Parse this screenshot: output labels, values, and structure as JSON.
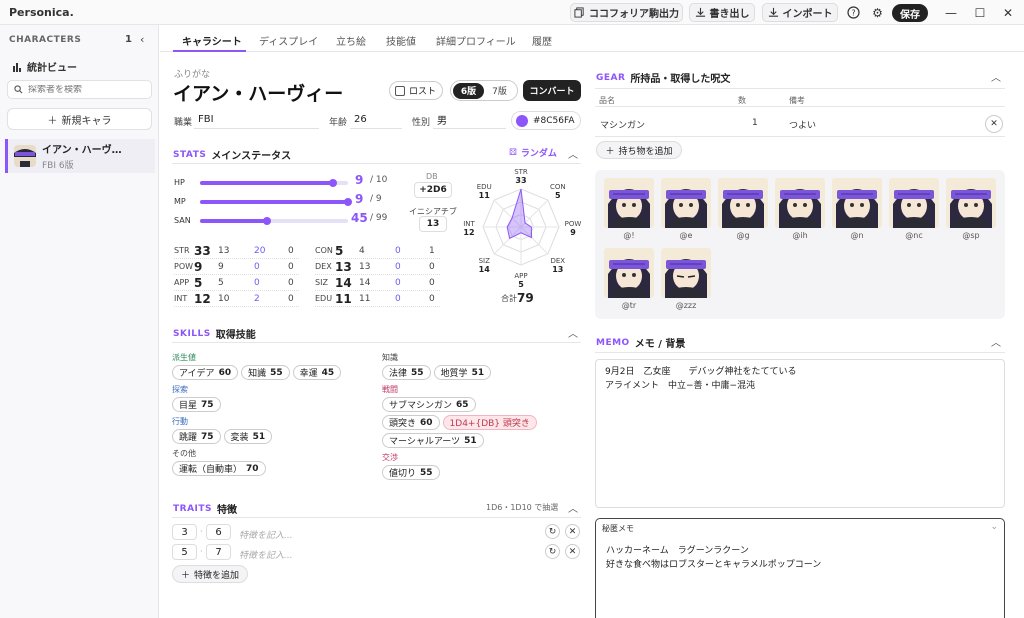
{
  "app": {
    "title": "Personica."
  },
  "toolbar": {
    "ccfolia": "ココフォリア駒出力",
    "export": "書き出し",
    "import": "インポート",
    "save": "保存"
  },
  "sidebar": {
    "header": "CHARACTERS",
    "count": "1",
    "stats_view": "統計ビュー",
    "search_placeholder": "探索者を検索",
    "new_char": "新規キャラ",
    "characters": [
      {
        "name": "イアン・ハーヴ…",
        "sub": "FBI  6版"
      }
    ]
  },
  "tabs": [
    "キャラシート",
    "ディスプレイ",
    "立ち絵",
    "技能値",
    "詳細プロフィール",
    "履歴"
  ],
  "character": {
    "furigana_label": "ふりがな",
    "name": "イアン・ハーヴィー",
    "lost_label": "ロスト",
    "edition6": "6版",
    "edition7": "7版",
    "convert": "コンバート",
    "job_label": "職業",
    "job": "FBI",
    "age_label": "年齢",
    "age": "26",
    "sex_label": "性別",
    "sex": "男",
    "color": "#8C56FA",
    "color_label": "#8C56FA"
  },
  "stats": {
    "en": "STATS",
    "jp": "メインステータス",
    "random": "ランダム",
    "bars": [
      {
        "label": "HP",
        "value": "9",
        "max": "/ 10",
        "fraction": 0.9
      },
      {
        "label": "MP",
        "value": "9",
        "max": "/ 9",
        "fraction": 1.0
      },
      {
        "label": "SAN",
        "value": "45",
        "max": "/ 99",
        "fraction": 0.4545
      }
    ],
    "db_label": "DB",
    "db": "+2D6",
    "init_label": "イニシアチブ",
    "init": "13",
    "abilities_left": [
      {
        "name": "STR",
        "total": "33",
        "a": "13",
        "b": "20",
        "c": "0"
      },
      {
        "name": "POW",
        "total": "9",
        "a": "9",
        "b": "0",
        "c": "0"
      },
      {
        "name": "APP",
        "total": "5",
        "a": "5",
        "b": "0",
        "c": "0"
      },
      {
        "name": "INT",
        "total": "12",
        "a": "10",
        "b": "2",
        "c": "0"
      }
    ],
    "abilities_right": [
      {
        "name": "CON",
        "total": "5",
        "a": "4",
        "b": "0",
        "c": "1"
      },
      {
        "name": "DEX",
        "total": "13",
        "a": "13",
        "b": "0",
        "c": "0"
      },
      {
        "name": "SIZ",
        "total": "14",
        "a": "14",
        "b": "0",
        "c": "0"
      },
      {
        "name": "EDU",
        "total": "11",
        "a": "11",
        "b": "0",
        "c": "0"
      }
    ],
    "radar": [
      {
        "name": "STR",
        "value": "33"
      },
      {
        "name": "CON",
        "value": "5"
      },
      {
        "name": "POW",
        "value": "9"
      },
      {
        "name": "DEX",
        "value": "13"
      },
      {
        "name": "APP",
        "value": "5"
      },
      {
        "name": "SIZ",
        "value": "14"
      },
      {
        "name": "INT",
        "value": "12"
      },
      {
        "name": "EDU",
        "value": "11"
      }
    ],
    "total_label": "合計",
    "total": "79"
  },
  "skills": {
    "en": "SKILLS",
    "jp": "取得技能",
    "left": [
      {
        "cat": "派生値",
        "items": [
          [
            "アイデア",
            "60"
          ],
          [
            "知識",
            "55"
          ],
          [
            "幸運",
            "45"
          ]
        ]
      },
      {
        "cat": "探索",
        "items": [
          [
            "目星",
            "75"
          ]
        ]
      },
      {
        "cat": "行動",
        "items": [
          [
            "跳躍",
            "75"
          ],
          [
            "変装",
            "51"
          ]
        ]
      },
      {
        "cat": "その他",
        "items": [
          [
            "運転（自動車）",
            "70"
          ]
        ]
      }
    ],
    "right": [
      {
        "cat": "知識",
        "items": [
          [
            "法律",
            "55"
          ],
          [
            "地質学",
            "51"
          ]
        ]
      },
      {
        "cat": "戦闘",
        "items": [
          [
            "サブマシンガン",
            "65"
          ],
          [
            "頭突き",
            "60"
          ],
          [
            "マーシャルアーツ",
            "51"
          ]
        ]
      },
      {
        "cat": "交渉",
        "items": [
          [
            "値切り",
            "55"
          ]
        ]
      }
    ],
    "headbutt_damage": "1D4+{DB} 頭突き"
  },
  "traits": {
    "en": "TRAITS",
    "jp": "特徴",
    "roll": "1D6・1D10 で抽選",
    "rows": [
      {
        "a": "3",
        "b": "6"
      },
      {
        "a": "5",
        "b": "7"
      }
    ],
    "placeholder": "特徴を記入...",
    "add": "特徴を追加"
  },
  "gear": {
    "en": "GEAR",
    "jp": "所持品・取得した呪文",
    "cols": [
      "品名",
      "数",
      "備考"
    ],
    "items": [
      {
        "name": "マシンガン",
        "qty": "1",
        "note": "つよい"
      }
    ],
    "add": "持ち物を追加"
  },
  "portraits": [
    "@!",
    "@e",
    "@g",
    "@ih",
    "@n",
    "@nc",
    "@sp",
    "@tr",
    "@zzz"
  ],
  "memo": {
    "en": "MEMO",
    "jp": "メモ / 背景",
    "text": "9月2日　乙女座　　デバッグ神社をたてている\nアライメント　中立−善・中庸−混沌",
    "secret_label": "秘匿メモ",
    "secret_text": "ハッカーネーム　ラグーンラクーン\n好きな食べ物はロブスターとキャラメルポップコーン"
  }
}
